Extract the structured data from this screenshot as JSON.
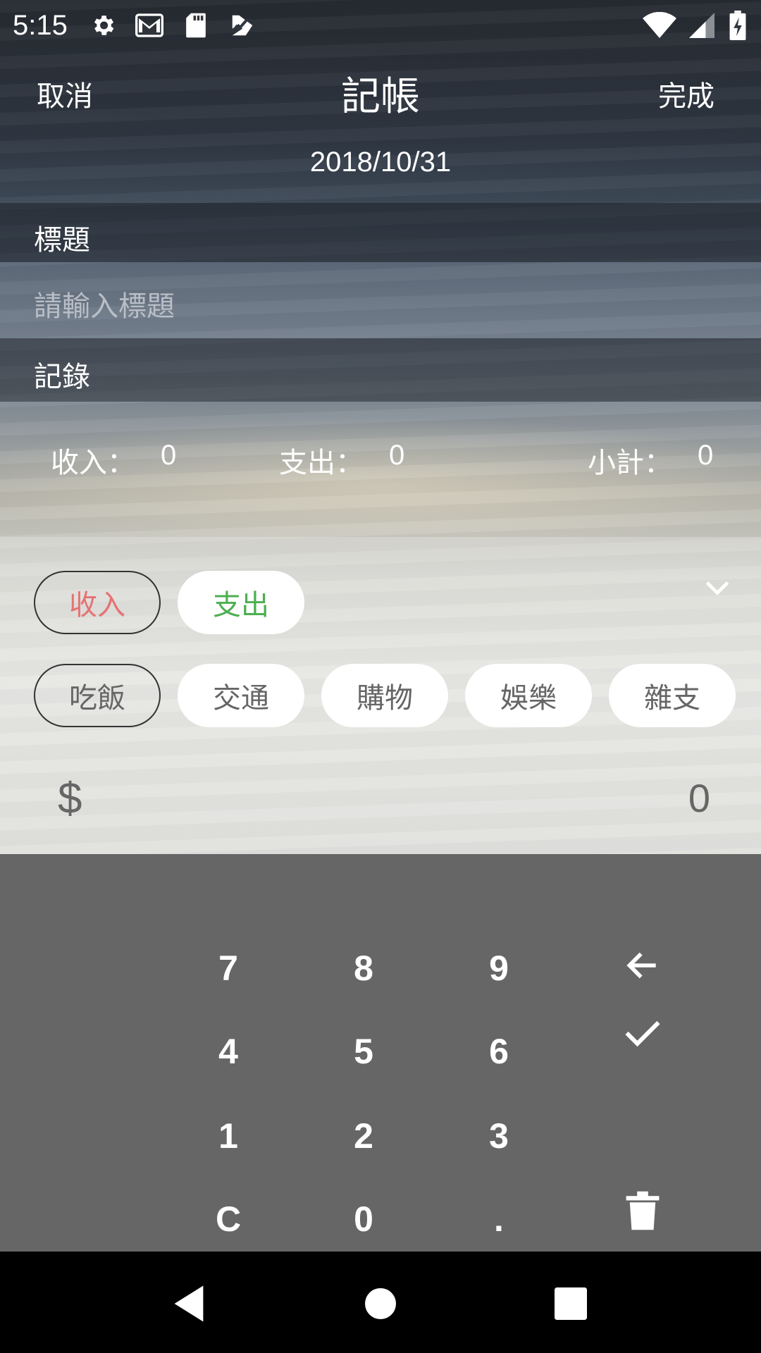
{
  "status_bar": {
    "time": "5:15",
    "left_icons": [
      "settings-icon",
      "gmail-icon",
      "sd-card-icon",
      "checkmark-app-icon"
    ],
    "right_icons": [
      "wifi-icon",
      "cellular-signal-icon",
      "battery-charging-icon"
    ]
  },
  "header": {
    "cancel_label": "取消",
    "title": "記帳",
    "done_label": "完成",
    "date": "2018/10/31"
  },
  "form": {
    "title_label": "標題",
    "title_placeholder": "請輸入標題",
    "record_label": "記錄"
  },
  "summary": {
    "income_label": "收入：",
    "income_value": "0",
    "expense_label": "支出：",
    "expense_value": "0",
    "subtotal_label": "小計：",
    "subtotal_value": "0"
  },
  "entry": {
    "type_tabs": [
      {
        "label": "收入",
        "selected": true
      },
      {
        "label": "支出",
        "selected": false
      }
    ],
    "categories": [
      {
        "label": "吃飯",
        "selected": true
      },
      {
        "label": "交通",
        "selected": false
      },
      {
        "label": "購物",
        "selected": false
      },
      {
        "label": "娛樂",
        "selected": false
      },
      {
        "label": "雜支",
        "selected": false
      }
    ],
    "currency_symbol": "$",
    "amount": "0"
  },
  "keypad": {
    "keys": [
      "7",
      "8",
      "9",
      "4",
      "5",
      "6",
      "1",
      "2",
      "3",
      "C",
      "0",
      "."
    ],
    "icons": [
      "backspace-arrow-icon",
      "confirm-check-icon",
      "trash-icon"
    ]
  },
  "colors": {
    "income": "#e57373",
    "expense": "#4caf50",
    "keypad_bg": "#666666"
  }
}
